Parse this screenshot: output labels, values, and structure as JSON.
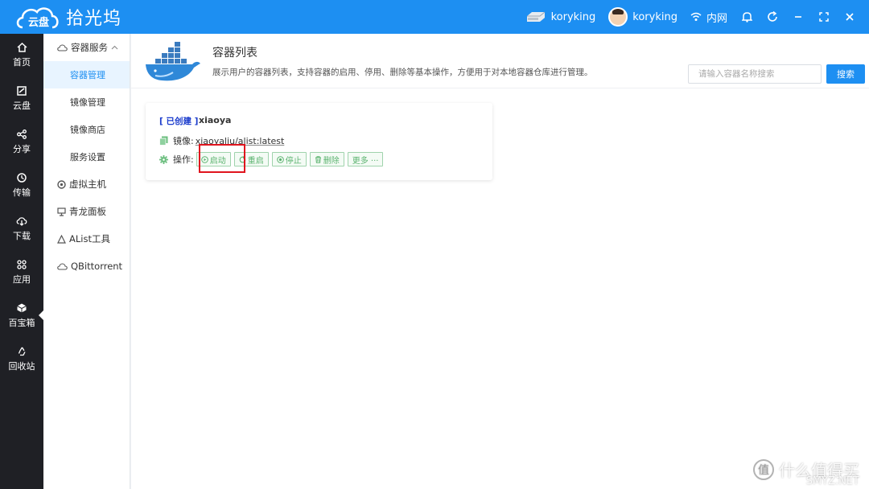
{
  "app": {
    "logo_badge": "云盘",
    "title": "拾光坞"
  },
  "topbar": {
    "device_name": "koryking",
    "user_name": "koryking",
    "network_label": "内网"
  },
  "nav": {
    "items": [
      {
        "label": "首页",
        "icon": "home-icon"
      },
      {
        "label": "云盘",
        "icon": "cloud-disk-icon"
      },
      {
        "label": "分享",
        "icon": "share-icon"
      },
      {
        "label": "传输",
        "icon": "transfer-icon"
      },
      {
        "label": "下载",
        "icon": "download-icon"
      },
      {
        "label": "应用",
        "icon": "apps-icon"
      },
      {
        "label": "百宝箱",
        "icon": "toolbox-icon",
        "active": true
      },
      {
        "label": "回收站",
        "icon": "recycle-icon"
      }
    ]
  },
  "subnav": {
    "group": "容器服务",
    "items": [
      "容器管理",
      "镜像管理",
      "镜像商店",
      "服务设置"
    ],
    "extra": [
      "虚拟主机",
      "青龙面板",
      "AList工具",
      "QBittorrent"
    ]
  },
  "page": {
    "title": "容器列表",
    "description": "展示用户的容器列表，支持容器的启用、停用、删除等基本操作，方便用于对本地容器仓库进行管理。",
    "search_placeholder": "请输入容器名称搜索",
    "search_button": "搜索"
  },
  "container": {
    "status": "[ 已创建 ]",
    "name": "xiaoya",
    "image_label": "镜像:",
    "image_value": "xiaoyaliu/alist:latest",
    "ops_label": "操作:",
    "ops": [
      "启动",
      "重启",
      "停止",
      "删除",
      "更多 ···"
    ]
  },
  "watermark": {
    "text": "什么值得买",
    "sub": "SMYZ.NET"
  },
  "colors": {
    "primary": "#1d8ff2",
    "nav_bg": "#1f2025",
    "op_green": "#5bb36f",
    "status_blue": "#1a3bcc",
    "highlight_red": "#e0141e"
  }
}
